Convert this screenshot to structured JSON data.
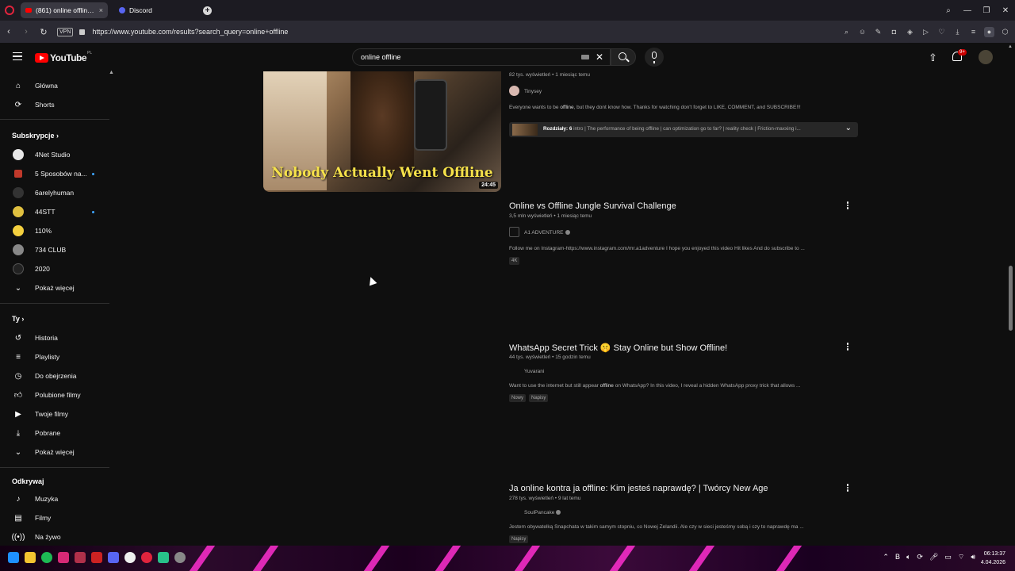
{
  "browser": {
    "tabs": [
      {
        "label": "(861) online offline - YouTu",
        "active": true
      },
      {
        "label": "Discord",
        "active": false
      }
    ],
    "url": "https://www.youtube.com/results?search_query=online+offline",
    "vpn_label": "VPN"
  },
  "youtube": {
    "logo_text": "YouTube",
    "country": "PL",
    "search_value": "online offline",
    "notification_badge": "9+"
  },
  "sidebar": {
    "main": [
      {
        "label": "Główna",
        "icon": "home-icon"
      },
      {
        "label": "Shorts",
        "icon": "shorts-icon"
      }
    ],
    "subscriptions_title": "Subskrypcje",
    "subscriptions": [
      {
        "label": "4Net Studio",
        "color": "#e8e8e8",
        "new": false
      },
      {
        "label": "5 Sposobów na...",
        "color": "#c0392b",
        "new": true
      },
      {
        "label": "6arelyhuman",
        "color": "#333333",
        "new": false
      },
      {
        "label": "44STT",
        "color": "#e0c040",
        "new": true
      },
      {
        "label": "110%",
        "color": "#f4d03f",
        "new": false
      },
      {
        "label": "734 CLUB",
        "color": "#888888",
        "new": false
      },
      {
        "label": "2020",
        "color": "#222222",
        "new": false
      }
    ],
    "show_more": "Pokaż więcej",
    "you_title": "Ty",
    "you": [
      {
        "label": "Historia",
        "icon": "history-icon"
      },
      {
        "label": "Playlisty",
        "icon": "playlist-icon"
      },
      {
        "label": "Do obejrzenia",
        "icon": "watch-later-icon"
      },
      {
        "label": "Polubione filmy",
        "icon": "like-icon"
      },
      {
        "label": "Twoje filmy",
        "icon": "your-videos-icon"
      },
      {
        "label": "Pobrane",
        "icon": "download-icon"
      }
    ],
    "show_more_2": "Pokaż więcej",
    "explore_title": "Odkrywaj",
    "explore": [
      {
        "label": "Muzyka",
        "icon": "music-icon"
      },
      {
        "label": "Filmy",
        "icon": "movies-icon"
      },
      {
        "label": "Na żywo",
        "icon": "live-icon"
      }
    ]
  },
  "results": [
    {
      "meta": "82 tys. wyświetleń • 1 miesiąc temu",
      "channel": "Tinysey",
      "desc_pre": "Everyone wants to be ",
      "desc_bold": "offline",
      "desc_post": ", but they dont know how. Thanks for watching don't forget to LIKE, COMMENT, and SUBSCRIBE!!!",
      "thumb_text": "Nobody Actually Went Offline",
      "duration": "24:45",
      "chapters_label": "Rozdziały: 6",
      "chapters_text": "intro | The performance of being offline | can optimization go to far? | reality check | Friction-maxxing i..."
    },
    {
      "title": "Online vs Offline Jungle Survival Challenge",
      "meta": "3,5 mln wyświetleń • 1 miesiąc temu",
      "channel": "A1 ADVENTURE",
      "desc": "Follow me on Instagram-https://www.instagram.com/mr.a1adventure I hope you enjoyed this video Hit likes And do subscribe to ...",
      "badges": [
        "4K"
      ]
    },
    {
      "title": "WhatsApp Secret Trick 🤫 Stay Online but Show Offline!",
      "meta": "44 tys. wyświetleń • 15 godzin temu",
      "channel": "Yuvarani",
      "desc_pre": "Want to use the internet but still appear ",
      "desc_bold": "offline",
      "desc_post": " on WhatsApp? In this video, I reveal a hidden WhatsApp proxy trick that allows ...",
      "badges": [
        "Nowy",
        "Napisy"
      ]
    },
    {
      "title": "Ja online kontra ja offline: Kim jesteś naprawdę? | Twórcy New Age",
      "meta": "278 tys. wyświetleń • 9 lat temu",
      "channel": "SoulPancake",
      "desc": "Jestem obywatelką Snapchata w takim samym stopniu, co Nowej Zelandii. Ale czy w sieci jesteśmy sobą i czy to naprawdę ma ...",
      "badges": [
        "Napisy"
      ]
    }
  ],
  "taskbar": {
    "time": "06:13:37",
    "date": "4.04.2026"
  }
}
